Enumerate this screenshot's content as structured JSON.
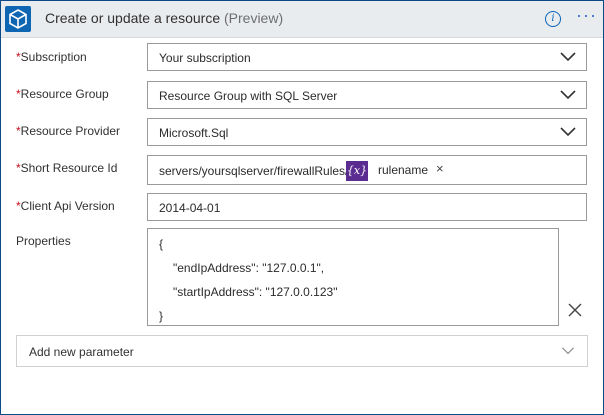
{
  "header": {
    "title": "Create or update a resource",
    "preview": "(Preview)"
  },
  "fields": [
    {
      "label": "Subscription",
      "value": "Your subscription"
    },
    {
      "label": "Resource Group",
      "value": "Resource Group with SQL Server"
    },
    {
      "label": "Resource Provider",
      "value": "Microsoft.Sql"
    },
    {
      "label": "Short Resource Id",
      "value": "servers/yoursqlserver/firewallRules/",
      "token_icon": "{x}",
      "token_label": "rulename",
      "token_remove": "×"
    },
    {
      "label": "Client Api Version",
      "value": "2014-04-01"
    }
  ],
  "properties": {
    "label": "Properties",
    "lines": [
      "{",
      "\"endIpAddress\": \"127.0.0.1\",",
      "\"startIpAddress\": \"127.0.0.123\"",
      "}"
    ]
  },
  "add_parameter": {
    "placeholder": "Add new parameter"
  },
  "colors": {
    "accent": "#0a63b8",
    "token": "#5c2d91",
    "required": "#c50f1f",
    "border": "#0b4a87"
  }
}
